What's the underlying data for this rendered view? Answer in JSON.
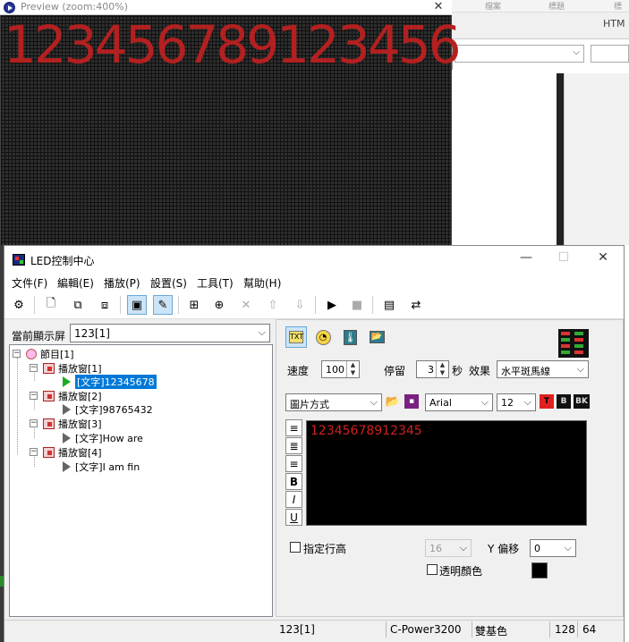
{
  "background_window": {
    "tab_labels": [
      "檔案",
      "標題",
      "標"
    ],
    "html_label": "HTM"
  },
  "preview": {
    "title": "Preview (zoom:400%)",
    "close_label": "✕",
    "led_text": "123456789123456"
  },
  "main_window": {
    "title": "LED控制中心",
    "minimize": "—",
    "maximize": "☐",
    "close": "✕"
  },
  "menu": [
    "文件(F)",
    "編輯(E)",
    "播放(P)",
    "設置(S)",
    "工具(T)",
    "幫助(H)"
  ],
  "toolbar": {
    "icons": [
      "settings-icon",
      "new-file-icon",
      "import-icon",
      "export-icon",
      "preview-icon",
      "edit-icon",
      "add-window-icon",
      "add-item-icon",
      "delete-icon",
      "move-up-icon",
      "move-down-icon",
      "play-icon",
      "stop-icon",
      "send-icon",
      "transfer-icon"
    ]
  },
  "current_screen": {
    "label": "當前顯示屏",
    "value": "123[1]"
  },
  "tree": {
    "root": "節目[1]",
    "windows": [
      {
        "label": "播放窗[1]",
        "item": "[文字]12345678",
        "selected": true
      },
      {
        "label": "播放窗[2]",
        "item": "[文字]98765432",
        "selected": false
      },
      {
        "label": "播放窗[3]",
        "item": "[文字]How are",
        "selected": false
      },
      {
        "label": "播放窗[4]",
        "item": "[文字]I am fin",
        "selected": false
      }
    ]
  },
  "props": {
    "speed_label": "速度",
    "speed_value": "100",
    "pause_label": "停留",
    "pause_value": "3",
    "seconds_label": "秒",
    "effect_label": "效果",
    "effect_value": "水平斑馬線",
    "mode_value": "圖片方式",
    "font_value": "Arial",
    "size_value": "12",
    "color_t": "T",
    "color_b": "B",
    "color_bk": "BK",
    "text_content": "12345678912345",
    "line_height_label": "指定行高",
    "line_height_value": "16",
    "y_offset_label": "Y 偏移",
    "y_offset_value": "0",
    "transparent_label": "透明顏色",
    "bold": "B",
    "italic": "I",
    "underline": "U"
  },
  "colors": {
    "led_red": "#b32020",
    "selection": "#0078d7",
    "toolbar_active": "#cce4f7"
  },
  "status": {
    "screen": "123[1]",
    "controller": "C-Power3200",
    "color_mode": "雙基色",
    "width": "128",
    "height": "64"
  }
}
